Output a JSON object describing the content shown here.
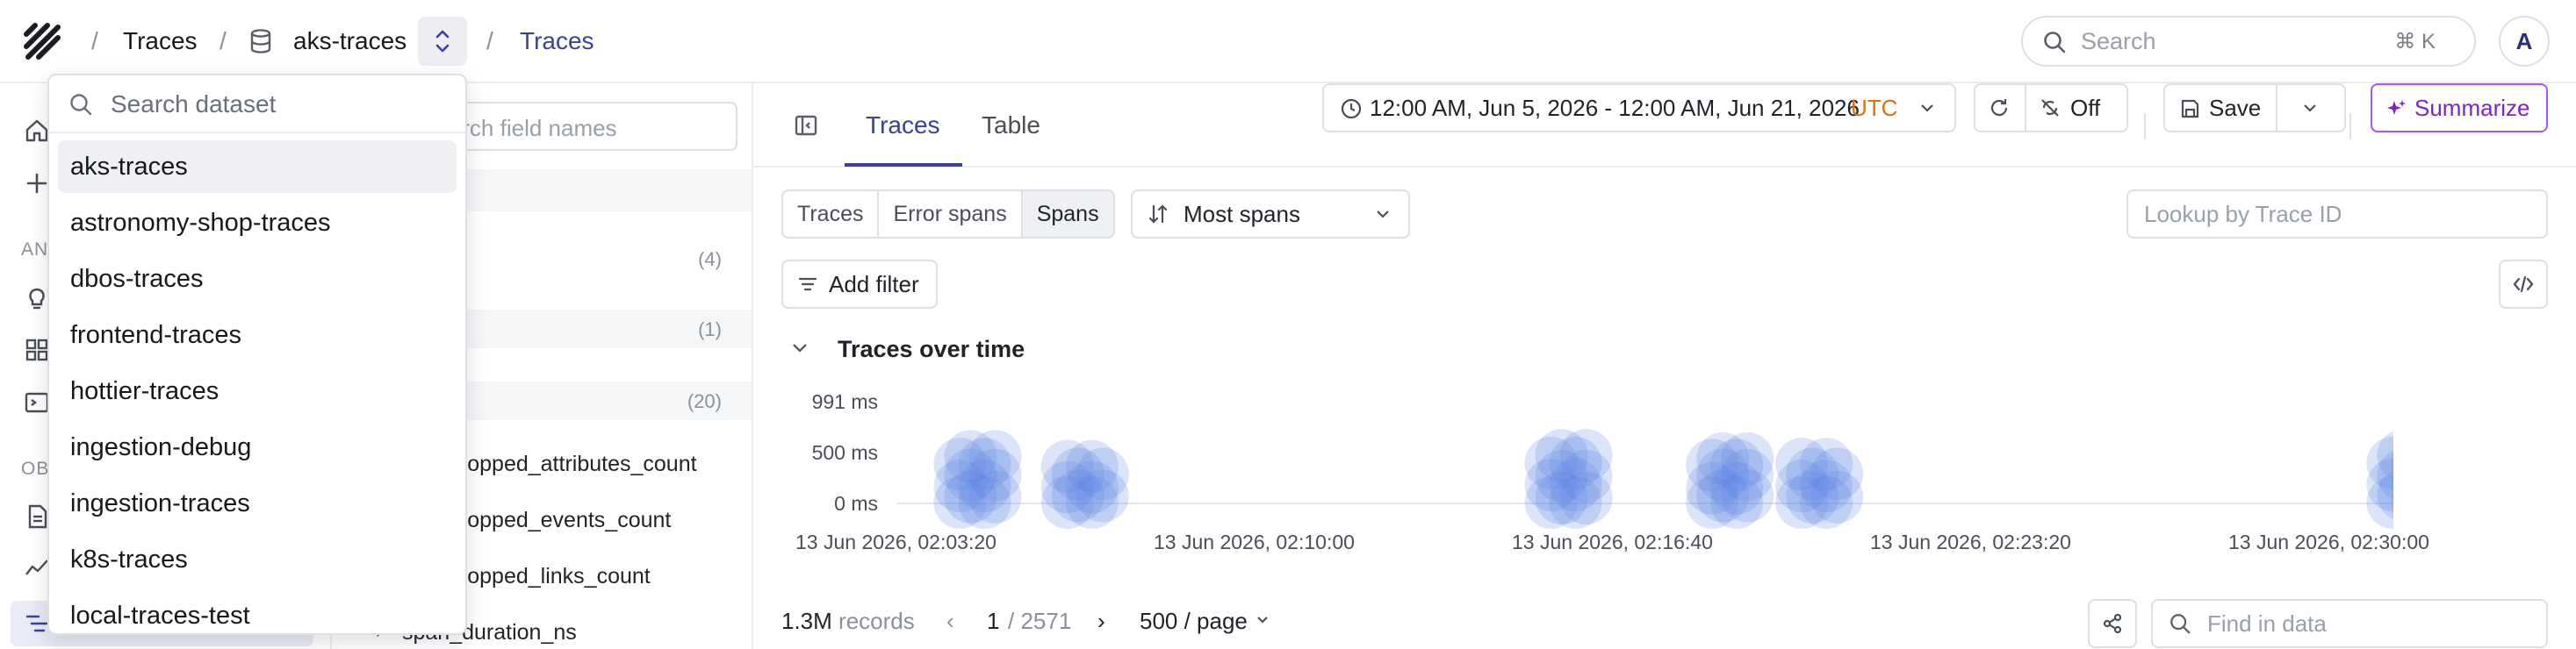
{
  "breadcrumb": {
    "root": "Traces",
    "dataset": "aks-traces",
    "current": "Traces",
    "separator": "/"
  },
  "top_search": {
    "placeholder": "Search",
    "shortcut": "⌘ K"
  },
  "avatar": "A",
  "nav": {
    "section_analyze": "AN",
    "section_observe": "OB"
  },
  "fields_panel": {
    "search_placeholder": "Search field names",
    "counts": [
      "(4)",
      "(1)",
      "(20)"
    ],
    "field_names": [
      "dropped_attributes_count",
      "dropped_events_count",
      "dropped_links_count",
      "span_duration_ns"
    ]
  },
  "dataset_dropdown": {
    "placeholder": "Search dataset",
    "items": [
      {
        "label": "aks-traces",
        "selected": true
      },
      {
        "label": "astronomy-shop-traces",
        "selected": false
      },
      {
        "label": "dbos-traces",
        "selected": false
      },
      {
        "label": "frontend-traces",
        "selected": false
      },
      {
        "label": "hottier-traces",
        "selected": false
      },
      {
        "label": "ingestion-debug",
        "selected": false
      },
      {
        "label": "ingestion-traces",
        "selected": false
      },
      {
        "label": "k8s-traces",
        "selected": false
      },
      {
        "label": "local-traces-test",
        "selected": false
      }
    ]
  },
  "tabs": [
    {
      "label": "Traces",
      "active": true
    },
    {
      "label": "Table",
      "active": false
    }
  ],
  "toolbar": {
    "time_range": "12:00 AM, Jun 5, 2026 - 12:00 AM, Jun 21, 2026",
    "timezone": "UTC",
    "auto_refresh": "Off",
    "save": "Save",
    "summarize": "Summarize"
  },
  "view_modes": [
    "Traces",
    "Error spans",
    "Spans"
  ],
  "sort": "Most spans",
  "trace_lookup_placeholder": "Lookup by Trace ID",
  "add_filter": "Add filter",
  "chart_data": {
    "type": "scatter",
    "title": "Traces over time",
    "y_ticks": [
      "991 ms",
      "500 ms",
      "0 ms"
    ],
    "ylim": [
      0,
      991
    ],
    "x_ticks": [
      "13 Jun 2026, 02:03:20",
      "13 Jun 2026, 02:10:00",
      "13 Jun 2026, 02:16:40",
      "13 Jun 2026, 02:23:20",
      "13 Jun 2026, 02:30:00"
    ],
    "clusters": [
      {
        "x": "02:04:30",
        "y_ms": [
          0,
          50,
          150,
          250,
          350,
          420
        ]
      },
      {
        "x": "02:06:30",
        "y_ms": [
          0,
          60,
          140,
          260,
          330
        ]
      },
      {
        "x": "02:15:30",
        "y_ms": [
          0,
          40,
          160,
          240,
          360,
          430
        ]
      },
      {
        "x": "02:18:30",
        "y_ms": [
          0,
          60,
          130,
          250,
          340,
          400
        ]
      },
      {
        "x": "02:20:10",
        "y_ms": [
          0,
          50,
          150,
          260,
          350
        ]
      },
      {
        "x": "02:31:10",
        "y_ms": [
          0,
          70,
          160,
          250,
          360,
          430
        ]
      }
    ],
    "color": "#5b86e5"
  },
  "pagination": {
    "records": "1.3M",
    "records_label": "records",
    "page": "1",
    "total_pages": "/ 2571",
    "page_size": "500 / page"
  },
  "find_placeholder": "Find in data"
}
